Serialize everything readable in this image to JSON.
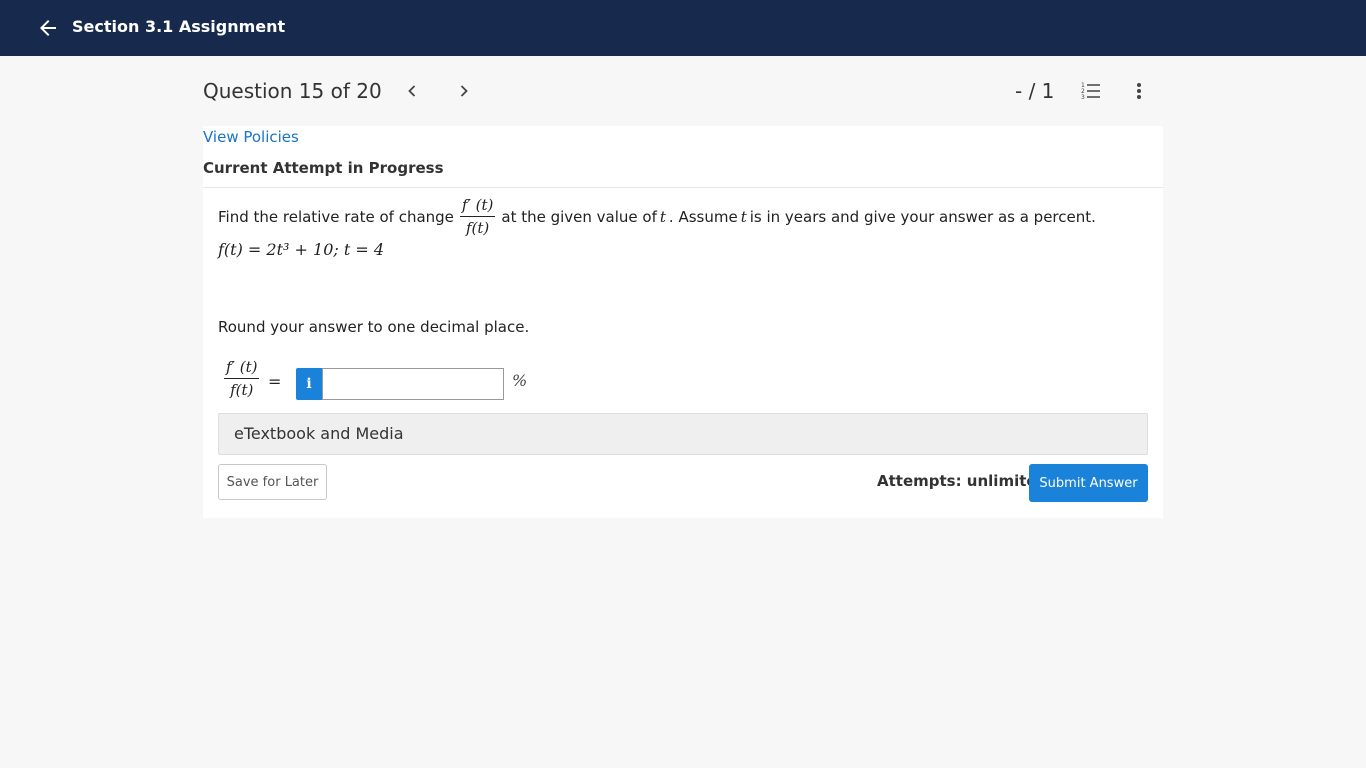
{
  "topbar": {
    "back_icon": "arrow-left-icon",
    "title": "Section 3.1 Assignment",
    "background": "#172a4e"
  },
  "question_header": {
    "title": "Question 15 of 20",
    "prev_icon": "chevron-left-icon",
    "next_icon": "chevron-right-icon",
    "score": "- / 1",
    "list_icon": "numbered-list-icon",
    "more_icon": "vertical-dots-icon"
  },
  "card": {
    "view_policies": "View Policies",
    "attempt_status": "Current Attempt in Progress"
  },
  "question": {
    "prompt_before": "Find the relative rate of change",
    "frac_num": "f′ (t)",
    "frac_den": "f(t)",
    "prompt_middle": "at the given value of",
    "var_t": "t",
    "prompt_assume": ". Assume",
    "prompt_after": "is in years and give your answer as a percent.",
    "function": "f(t) = 2t³ + 10; t = 4",
    "round_instruction": "Round your answer to one decimal place."
  },
  "answer": {
    "frac_num": "f′ (t)",
    "frac_den": "f(t)",
    "equals": "=",
    "info_icon": "info-icon",
    "info_glyph": "i",
    "input_value": "",
    "unit": "%"
  },
  "resources": {
    "etextbook_label": "eTextbook and Media"
  },
  "actions": {
    "save_label": "Save for Later",
    "attempts_text": "Attempts: unlimited",
    "submit_label": "Submit Answer",
    "accent": "#1a82d9"
  }
}
